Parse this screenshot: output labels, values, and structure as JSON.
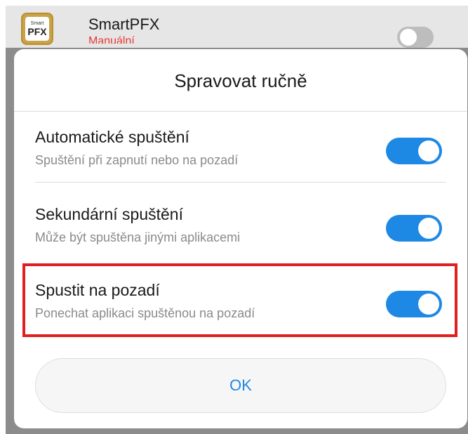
{
  "background_app": {
    "icon_text_small": "Smart",
    "icon_text_big": "PFX",
    "name": "SmartPFX",
    "status": "Manuální"
  },
  "dialog": {
    "title": "Spravovat ručně",
    "options": [
      {
        "label": "Automatické spuštění",
        "description": "Spuštění při zapnutí nebo na pozadí",
        "enabled": true
      },
      {
        "label": "Sekundární spuštění",
        "description": "Může být spuštěna jinými aplikacemi",
        "enabled": true
      },
      {
        "label": "Spustit na pozadí",
        "description": "Ponechat aplikaci spuštěnou na pozadí",
        "enabled": true,
        "highlighted": true
      }
    ],
    "ok_label": "OK"
  },
  "colors": {
    "accent": "#1e88e5",
    "highlight": "#e02020"
  }
}
